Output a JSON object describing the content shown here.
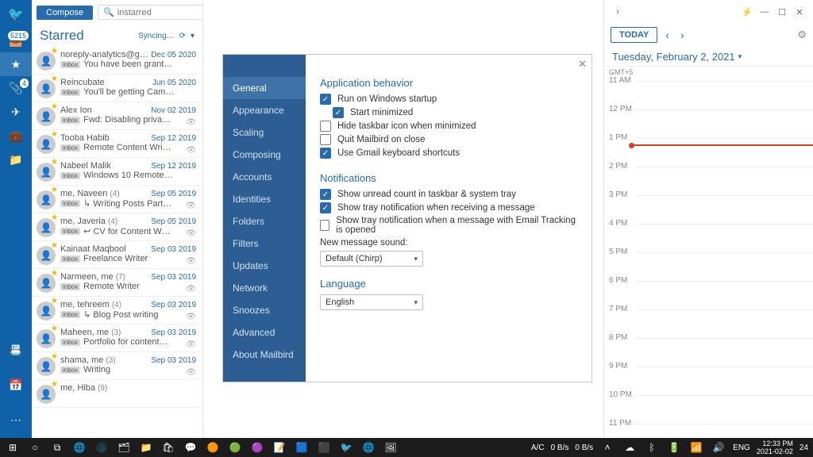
{
  "rail": {
    "badge_count": "5215",
    "attach_badge": "4"
  },
  "mail": {
    "compose": "Compose",
    "search_placeholder": "instarred",
    "title": "Starred",
    "syncing": "Syncing…",
    "messages": [
      {
        "from": "noreply-analytics@google.cor",
        "date": "Dec 05 2020",
        "preview": "You have been grant…",
        "tag": "inbox",
        "starred": true,
        "eye": false,
        "count": ""
      },
      {
        "from": "Reincubate",
        "date": "Jun 05 2020",
        "preview": "You'll be getting Cam…",
        "tag": "inbox",
        "starred": true,
        "eye": false,
        "count": ""
      },
      {
        "from": "Alex Ion",
        "date": "Nov 02 2019",
        "preview": "Fwd: Disabling priva…",
        "tag": "inbox",
        "starred": true,
        "eye": true,
        "count": ""
      },
      {
        "from": "Tooba Habib",
        "date": "Sep 12 2019",
        "preview": "Remote Content Wri…",
        "tag": "inbox",
        "starred": true,
        "eye": true,
        "count": ""
      },
      {
        "from": "Nabeel Malik",
        "date": "Sep 12 2019",
        "preview": "Windows 10 Remote…",
        "tag": "inbox",
        "starred": true,
        "eye": false,
        "count": ""
      },
      {
        "from": "me, Naveen",
        "date": "Sep 05 2019",
        "preview": "↳  Writing Posts Part…",
        "tag": "inbox",
        "starred": true,
        "eye": true,
        "count": "(4)"
      },
      {
        "from": "me, Javeria",
        "date": "Sep 05 2019",
        "preview": "↩  CV for Content W…",
        "tag": "inbox",
        "starred": true,
        "eye": true,
        "count": "(4)"
      },
      {
        "from": "Kainaat Maqbool",
        "date": "Sep 03 2019",
        "preview": "Freelance Writer",
        "tag": "inbox",
        "starred": true,
        "eye": true,
        "count": ""
      },
      {
        "from": "Narmeen, me",
        "date": "Sep 03 2019",
        "preview": "Remote Writer",
        "tag": "inbox",
        "starred": true,
        "eye": true,
        "count": "(7)"
      },
      {
        "from": "me, tehreem",
        "date": "Sep 03 2019",
        "preview": "↳  Blog Post writing",
        "tag": "inbox",
        "starred": true,
        "eye": true,
        "count": "(4)"
      },
      {
        "from": "Maheen, me",
        "date": "Sep 03 2019",
        "preview": "Portfolio for content…",
        "tag": "inbox",
        "starred": true,
        "eye": true,
        "count": "(3)"
      },
      {
        "from": "shama, me",
        "date": "Sep 03 2019",
        "preview": "Writing",
        "tag": "inbox",
        "starred": true,
        "eye": true,
        "count": "(3)"
      },
      {
        "from": "me, Hiba",
        "date": "",
        "preview": "",
        "tag": "",
        "starred": true,
        "eye": false,
        "count": "(9)"
      }
    ]
  },
  "settings": {
    "tabs": [
      "General",
      "Appearance",
      "Scaling",
      "Composing",
      "Accounts",
      "Identities",
      "Folders",
      "Filters",
      "Updates",
      "Network",
      "Snoozes",
      "Advanced",
      "About Mailbird"
    ],
    "selected_tab": 0,
    "section_app": "Application behavior",
    "opt_startup": "Run on Windows startup",
    "opt_start_min": "Start minimized",
    "opt_hide_taskbar": "Hide taskbar icon when minimized",
    "opt_quit_close": "Quit Mailbird on close",
    "opt_gmail_keys": "Use Gmail keyboard shortcuts",
    "section_notif": "Notifications",
    "opt_unread_tray": "Show unread count in taskbar & system tray",
    "opt_tray_receive": "Show tray notification when receiving a message",
    "opt_tray_track": "Show tray notification when a message with Email Tracking is opened",
    "label_sound": "New message sound:",
    "sound_value": "Default (Chirp)",
    "section_lang": "Language",
    "lang_value": "English",
    "checks": {
      "startup": true,
      "start_min": true,
      "hide_taskbar": false,
      "quit_close": false,
      "gmail_keys": true,
      "unread_tray": true,
      "tray_receive": true,
      "tray_track": false
    }
  },
  "calendar": {
    "today": "TODAY",
    "date": "Tuesday, February 2, 2021",
    "tz": "GMT+5",
    "hours": [
      "11 AM",
      "12 PM",
      "1 PM",
      "2 PM",
      "3 PM",
      "4 PM",
      "5 PM",
      "6 PM",
      "7 PM",
      "8 PM",
      "9 PM",
      "10 PM",
      "11 PM"
    ],
    "now_index": 2
  },
  "taskbar": {
    "kb": "A/C",
    "net": "0 B/s",
    "lang": "ENG",
    "time": "12:33 PM",
    "date": "2021-02-02",
    "notif": "24"
  }
}
